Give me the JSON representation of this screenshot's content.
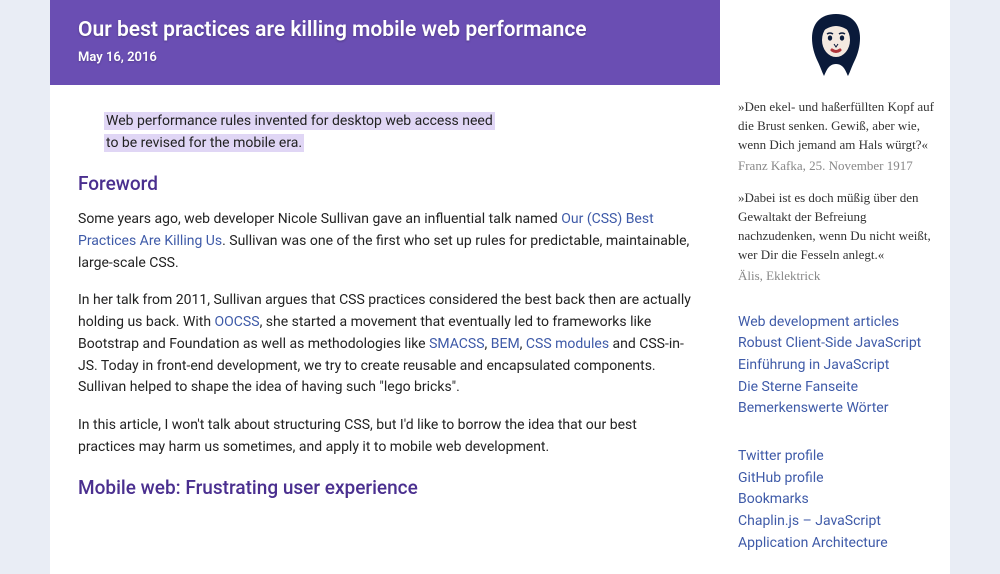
{
  "article": {
    "title": "Our best practices are killing mobile web performance",
    "date": "May 16, 2016",
    "lede1": "Web performance rules invented for desktop web access need",
    "lede2": "to be revised for the mobile era.",
    "h_foreword": "Foreword",
    "p1_a": "Some years ago, web developer Nicole Sullivan gave an influential talk named ",
    "p1_link": "Our (CSS) Best Practices Are Killing Us",
    "p1_b": ". Sullivan was one of the first who set up rules for predictable, maintainable, large-scale CSS.",
    "p2_a": "In her talk from 2011, Sullivan argues that CSS practices considered the best back then are actually holding us back. With ",
    "p2_oocss": "OOCSS",
    "p2_b": ", she started a movement that eventually led to frameworks like Bootstrap and Foundation as well as methodologies like ",
    "p2_smacss": "SMACSS",
    "p2_c": ", ",
    "p2_bem": "BEM",
    "p2_d": ", ",
    "p2_cssmod": "CSS modules",
    "p2_e": " and CSS-in-JS. Today in front-end development, we try to create reusable and encapsulated components. Sullivan helped to shape the idea of having such \"lego bricks\".",
    "p3": "In this article, I won't talk about structuring CSS, but I'd like to borrow the idea that our best practices may harm us sometimes, and apply it to mobile web development.",
    "h_mobile": "Mobile web: Frustrating user experience"
  },
  "sidebar": {
    "quotes": [
      {
        "text": "»Den ekel- und haßerfüllten Kopf auf die Brust senken. Gewiß, aber wie, wenn Dich jemand am Hals würgt?«",
        "attribution": "Franz Kafka, 25. November 1917"
      },
      {
        "text": "»Dabei ist es doch müßig über den Gewaltakt der Befreiung nachzudenken, wenn Du nicht weißt, wer Dir die Fesseln anlegt.«",
        "attribution": "Älis, Eklektrick"
      }
    ],
    "links1": [
      "Web development articles",
      "Robust Client-Side JavaScript",
      "Einführung in JavaScript",
      "Die Sterne Fanseite",
      "Bemerkenswerte Wörter"
    ],
    "links2": [
      "Twitter profile",
      "GitHub profile",
      "Bookmarks",
      "Chaplin.js – JavaScript Application Architecture"
    ]
  }
}
